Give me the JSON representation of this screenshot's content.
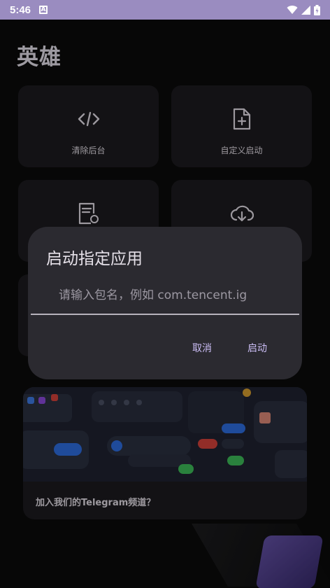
{
  "status_bar": {
    "time": "5:46",
    "notification_icon": "A"
  },
  "app": {
    "title": "英雄"
  },
  "tiles": [
    {
      "label": "清除后台",
      "icon": "code-icon"
    },
    {
      "label": "自定义启动",
      "icon": "file-add-icon"
    },
    {
      "label": "",
      "icon": "file-sync-icon"
    },
    {
      "label": "",
      "icon": "cloud-download-icon"
    }
  ],
  "promo": {
    "caption": "加入我们的Telegram频道？"
  },
  "dialog": {
    "title": "启动指定应用",
    "input_placeholder": "请输入包名，例如 com.tencent.ig",
    "input_value": "",
    "cancel_label": "取消",
    "confirm_label": "启动"
  },
  "colors": {
    "accent": "#cbbdf5",
    "status_bar": "#9a8cc0",
    "surface": "#1c1b1f",
    "dialog": "#2b2a30"
  }
}
